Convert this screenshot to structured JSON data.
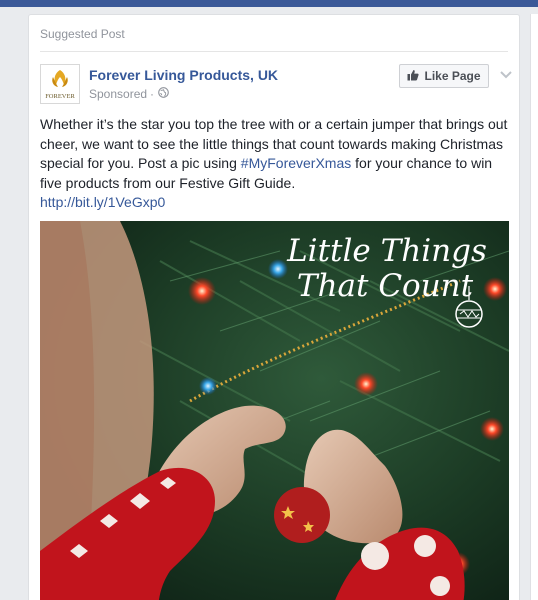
{
  "post": {
    "label": "Suggested Post",
    "page_name": "Forever Living Products, UK",
    "sponsored": "Sponsored",
    "separator": "·",
    "like_button": "Like Page",
    "avatar_text": "FOREVER",
    "text_part1": "Whether it’s the star you top the tree with or a certain jumper that brings out cheer, we want to see the little things that count towards making Christmas special for you. Post a pic using ",
    "hashtag": "#MyForeverXmas",
    "text_part2": " for your chance to win five products from our Festive Gift Guide.",
    "link": "http://bit.ly/1VeGxp0"
  },
  "image": {
    "headline_line1": "Little Things",
    "headline_line2": "That Count"
  },
  "colors": {
    "brand_blue": "#3b5998",
    "link_blue": "#365899",
    "meta_gray": "#90949c"
  },
  "icons": [
    "globe-icon",
    "thumbs-up-icon",
    "chevron-down-icon",
    "ornament-icon",
    "forever-logo-icon"
  ]
}
